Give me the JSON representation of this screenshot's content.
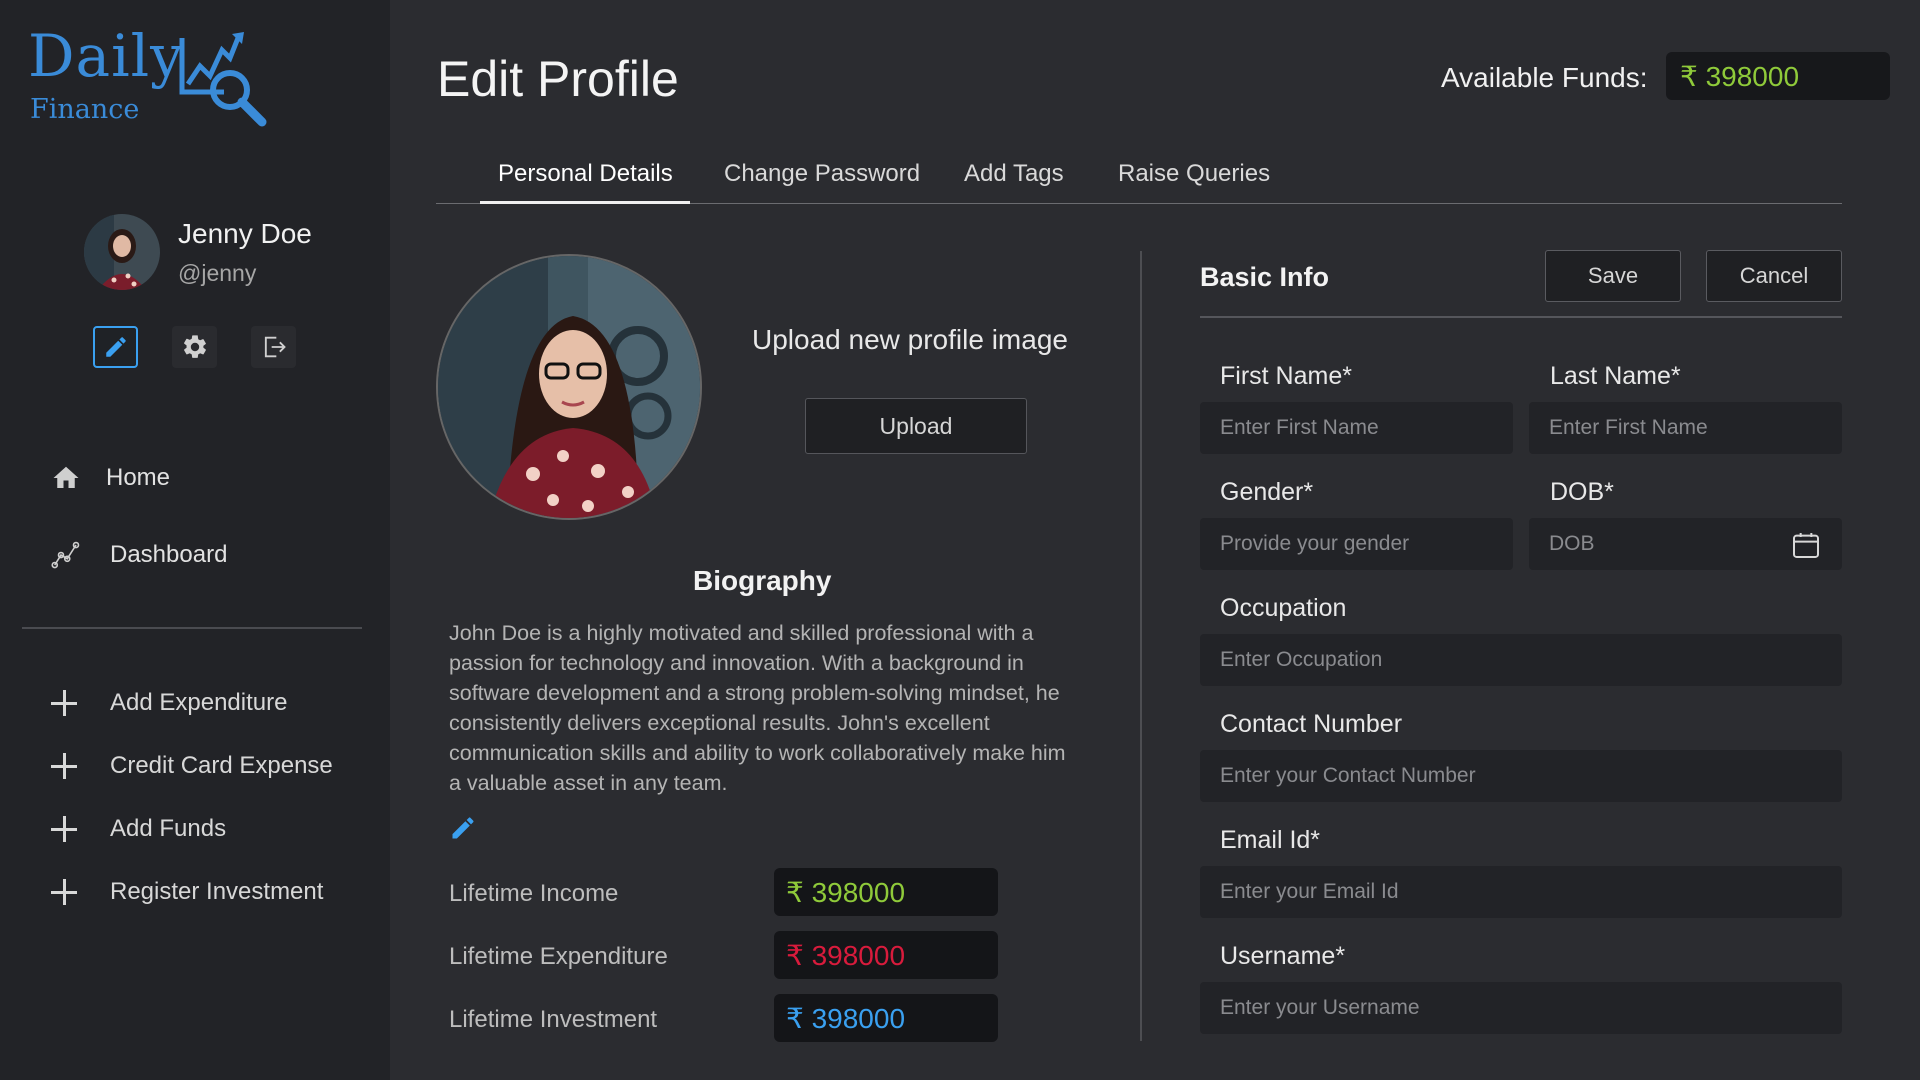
{
  "brand": {
    "name_top": "Daily",
    "name_bottom": "Finance"
  },
  "user": {
    "name": "Jenny Doe",
    "handle": "@jenny"
  },
  "nav": {
    "items": [
      {
        "label": "Home",
        "icon": "home-icon"
      },
      {
        "label": "Dashboard",
        "icon": "chart-line-icon"
      }
    ]
  },
  "actions": {
    "items": [
      "Add Expenditure",
      "Credit Card Expense",
      "Add Funds",
      "Register Investment"
    ]
  },
  "page": {
    "title": "Edit Profile",
    "funds_label": "Available Funds:",
    "funds_value": "₹ 398000"
  },
  "tabs": [
    "Personal Details",
    "Change Password",
    "Add Tags",
    "Raise Queries"
  ],
  "upload": {
    "title": "Upload new profile image",
    "button": "Upload"
  },
  "bio": {
    "title": "Biography",
    "text": "John Doe is a highly motivated and skilled professional with a passion for technology and innovation. With a background in software development and a strong problem-solving mindset, he consistently delivers exceptional results. John's excellent communication skills and ability to work collaboratively make him a valuable asset in any team."
  },
  "stats": [
    {
      "label": "Lifetime Income",
      "value": "₹ 398000",
      "color": "#8fca3a"
    },
    {
      "label": "Lifetime Expenditure",
      "value": "₹ 398000",
      "color": "#d81b3c"
    },
    {
      "label": "Lifetime Investment",
      "value": "₹ 398000",
      "color": "#3aa0f0"
    }
  ],
  "form": {
    "title": "Basic Info",
    "save": "Save",
    "cancel": "Cancel",
    "first_name": {
      "label": "First Name*",
      "placeholder": "Enter First Name"
    },
    "last_name": {
      "label": "Last Name*",
      "placeholder": "Enter First Name"
    },
    "gender": {
      "label": "Gender*",
      "placeholder": "Provide your gender"
    },
    "dob": {
      "label": "DOB*",
      "placeholder": "DOB"
    },
    "occupation": {
      "label": "Occupation",
      "placeholder": "Enter Occupation"
    },
    "contact": {
      "label": "Contact Number",
      "placeholder": "Enter your Contact Number"
    },
    "email": {
      "label": "Email Id*",
      "placeholder": "Enter your Email Id"
    },
    "username": {
      "label": "Username*",
      "placeholder": "Enter your Username"
    }
  },
  "colors": {
    "accent": "#3aa0f0",
    "brand": "#3a8bd8",
    "funds": "#8fca3a",
    "expense": "#d81b3c"
  }
}
